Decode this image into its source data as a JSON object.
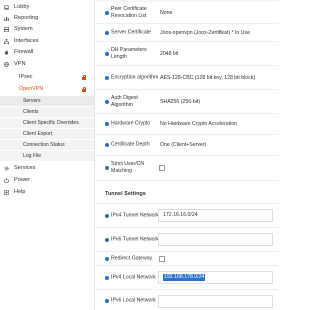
{
  "sidebar": {
    "items": [
      {
        "label": "Lobby",
        "icon": "laptop-icon"
      },
      {
        "label": "Reporting",
        "icon": "bar-chart-icon"
      },
      {
        "label": "System",
        "icon": "server-icon"
      },
      {
        "label": "Interfaces",
        "icon": "network-icon"
      },
      {
        "label": "Firewall",
        "icon": "fire-icon"
      },
      {
        "label": "VPN",
        "icon": "globe-icon"
      },
      {
        "label": "Services",
        "icon": "gears-icon"
      },
      {
        "label": "Power",
        "icon": "power-icon"
      },
      {
        "label": "Help",
        "icon": "help-icon"
      }
    ],
    "vpn_subitems": [
      {
        "label": "IPsec"
      },
      {
        "label": "OpenVPN"
      }
    ],
    "openvpn_items": [
      {
        "label": "Servers"
      },
      {
        "label": "Clients"
      },
      {
        "label": "Client Specific Overrides"
      },
      {
        "label": "Client Export"
      },
      {
        "label": "Connection Status"
      },
      {
        "label": "Log File"
      }
    ],
    "active_color": "#d94f00"
  },
  "settings": {
    "peer_cert_revocation": {
      "label": "Peer Certificate Revocation List",
      "value": "None"
    },
    "server_certificate": {
      "label": "Server Certificate",
      "value": "Joos-openvpn (Joos-Zertifikat) * In Use"
    },
    "dh_length": {
      "label": "DH Parameters Length",
      "value": "2048 bit"
    },
    "encryption": {
      "label": "Encryption algorithm",
      "value": "AES-128-CBC (128 bit key, 128 bit block)"
    },
    "auth_digest": {
      "label": "Auth Digest Algorithm",
      "value": "SHA256 (256-bit)"
    },
    "hardware_crypto": {
      "label": "Hardware Crypto",
      "value": "No Hardware Crypto Acceleration"
    },
    "cert_depth": {
      "label": "Certificate Depth",
      "value": "One (Client+Server)"
    },
    "strict_user_cn": {
      "label": "Strict User/CN Matching"
    }
  },
  "tunnel": {
    "section_title": "Tunnel Settings",
    "ipv4_tunnel": {
      "label": "IPv4 Tunnel Network",
      "value": "172.16.16.0/24"
    },
    "ipv6_tunnel": {
      "label": "IPv6 Tunnel Network",
      "value": ""
    },
    "redirect_gateway": {
      "label": "Redirect Gateway"
    },
    "ipv4_local": {
      "label": "IPv4 Local Network",
      "value": "192.168.178.0/24"
    },
    "ipv6_local": {
      "label": "IPv6 Local Network",
      "value": ""
    }
  },
  "colors": {
    "info": "#2a6fb8",
    "selection": "#2a73d1"
  }
}
